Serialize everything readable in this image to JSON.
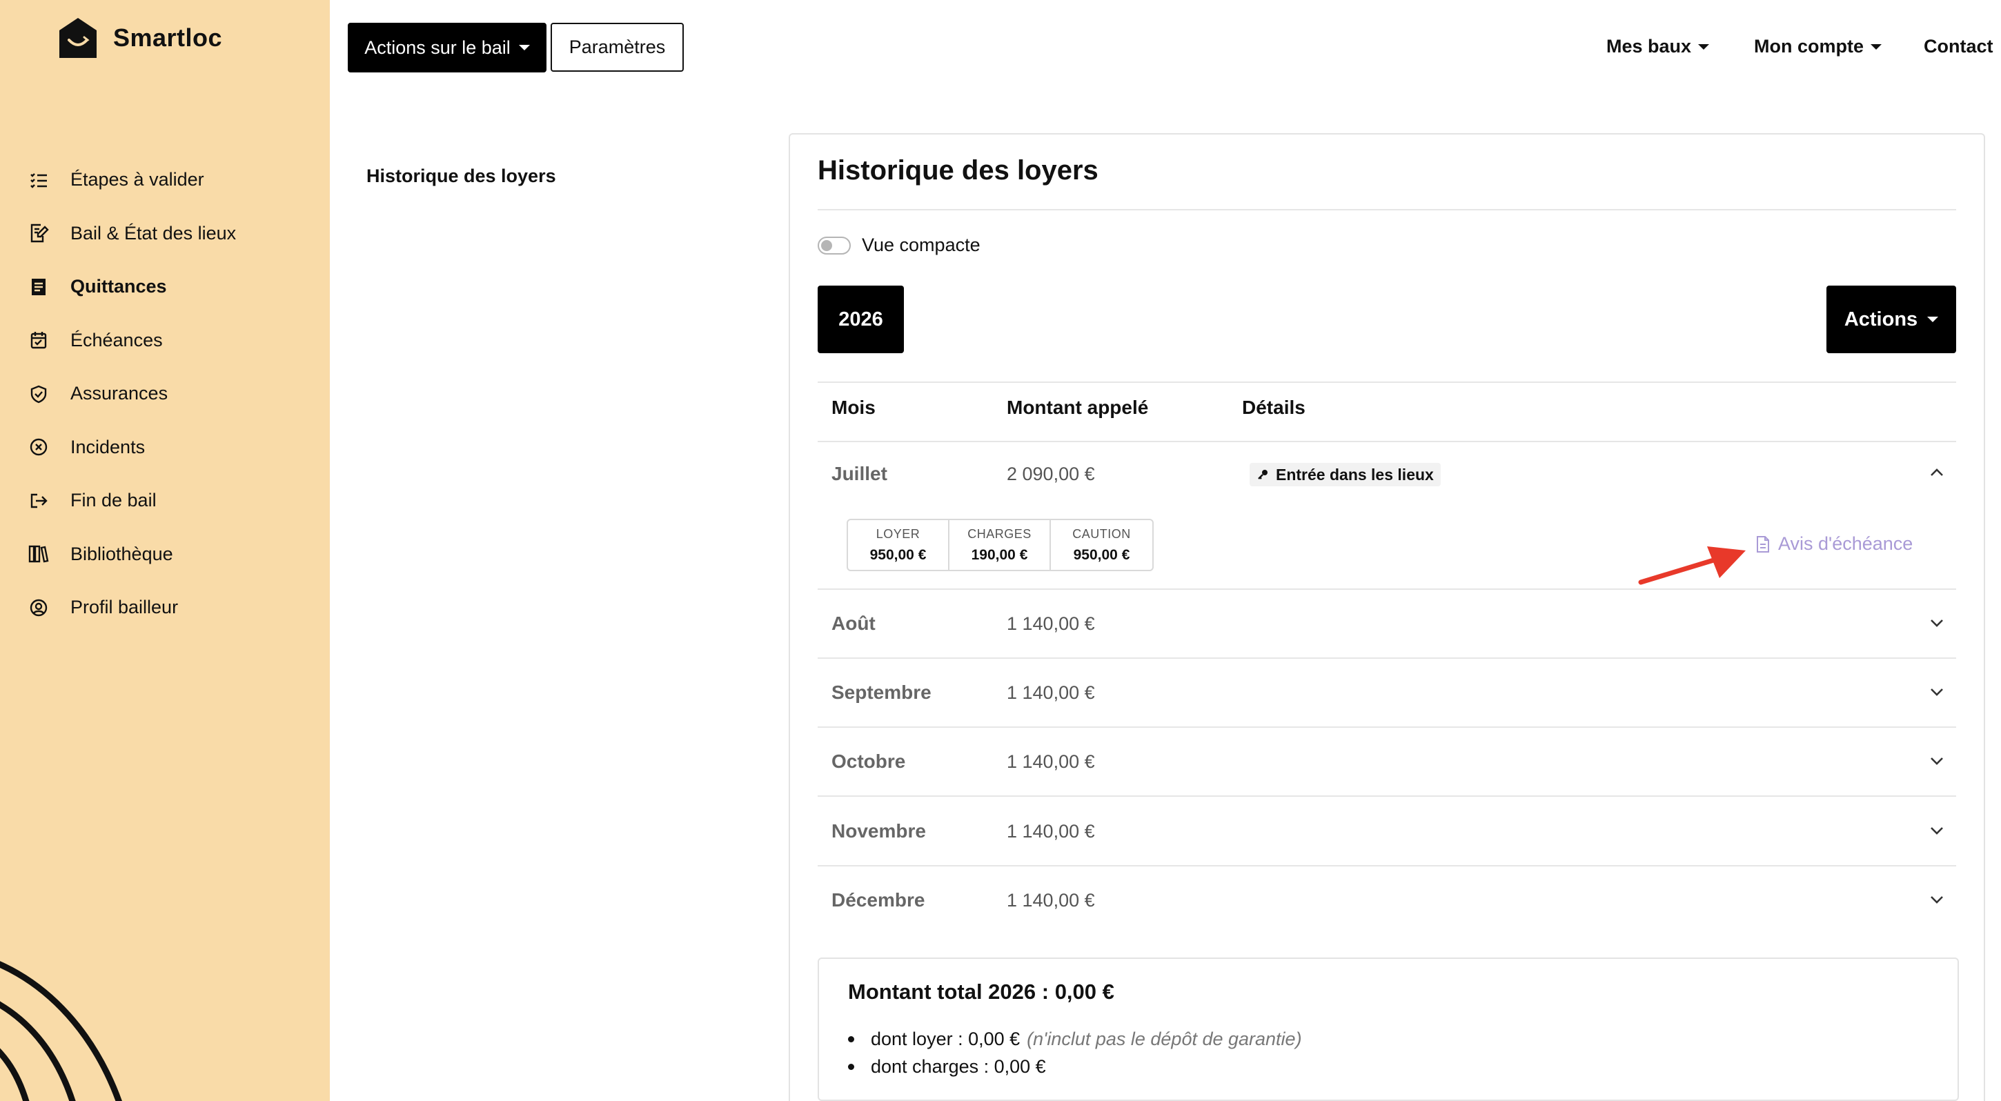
{
  "brand": {
    "name": "Smartloc"
  },
  "sidebar": {
    "items": [
      {
        "label": "Étapes à valider",
        "icon": "checklist-icon",
        "active": false
      },
      {
        "label": "Bail & État des lieux",
        "icon": "document-edit-icon",
        "active": false
      },
      {
        "label": "Quittances",
        "icon": "receipt-icon",
        "active": true
      },
      {
        "label": "Échéances",
        "icon": "calendar-check-icon",
        "active": false
      },
      {
        "label": "Assurances",
        "icon": "shield-check-icon",
        "active": false
      },
      {
        "label": "Incidents",
        "icon": "circle-x-icon",
        "active": false
      },
      {
        "label": "Fin de bail",
        "icon": "exit-arrow-icon",
        "active": false
      },
      {
        "label": "Bibliothèque",
        "icon": "books-icon",
        "active": false
      },
      {
        "label": "Profil bailleur",
        "icon": "user-circle-icon",
        "active": false
      }
    ]
  },
  "topbar": {
    "actions_label": "Actions sur le bail",
    "params_label": "Paramètres",
    "nav": {
      "mes_baux": "Mes baux",
      "mon_compte": "Mon compte",
      "contact": "Contact"
    }
  },
  "subnav": {
    "title": "Historique des loyers"
  },
  "card": {
    "title": "Historique des loyers",
    "compact_label": "Vue compacte",
    "compact_on": false,
    "year": "2026",
    "actions_label": "Actions",
    "columns": {
      "month": "Mois",
      "amount": "Montant appelé",
      "details": "Détails"
    },
    "expanded": {
      "month": "Juillet",
      "amount": "2 090,00 €",
      "detail_badge": "Entrée dans les lieux",
      "breakdown": [
        {
          "label": "LOYER",
          "value": "950,00 €"
        },
        {
          "label": "CHARGES",
          "value": "190,00 €"
        },
        {
          "label": "CAUTION",
          "value": "950,00 €"
        }
      ],
      "avis_label": "Avis d'échéance"
    },
    "rows": [
      {
        "month": "Août",
        "amount": "1 140,00 €"
      },
      {
        "month": "Septembre",
        "amount": "1 140,00 €"
      },
      {
        "month": "Octobre",
        "amount": "1 140,00 €"
      },
      {
        "month": "Novembre",
        "amount": "1 140,00 €"
      },
      {
        "month": "Décembre",
        "amount": "1 140,00 €"
      }
    ],
    "total": {
      "title": "Montant total 2026 : 0,00 €",
      "loyer": "dont loyer : 0,00 €",
      "loyer_note": "(n'inclut pas le dépôt de garantie)",
      "charges": "dont charges : 0,00 €"
    }
  },
  "colors": {
    "sidebar_bg": "#f9dba8",
    "accent_link": "#a99ad6",
    "annotation_arrow": "#e8392a"
  }
}
